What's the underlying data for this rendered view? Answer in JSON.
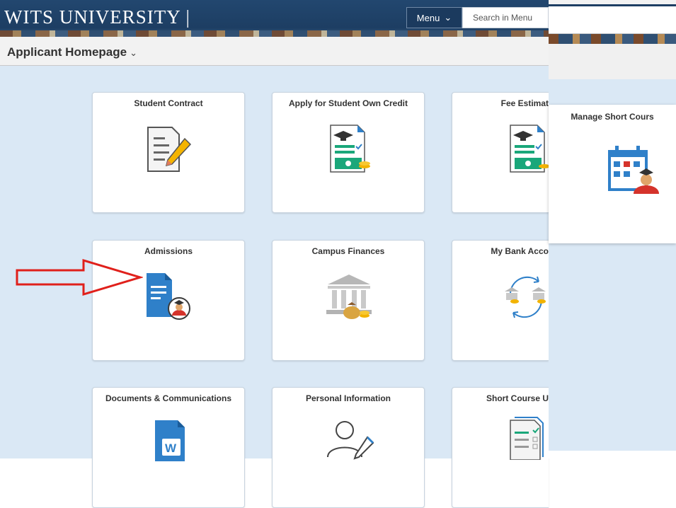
{
  "header": {
    "brand": "WITS UNIVERSITY |",
    "menu_label": "Menu",
    "search_placeholder": "Search in Menu"
  },
  "page": {
    "title": "Applicant Homepage",
    "title_caret": "⌄"
  },
  "tiles": [
    {
      "label": "Student Contract",
      "icon": "contract-document-icon"
    },
    {
      "label": "Apply for Student Own Credit",
      "icon": "credit-application-icon"
    },
    {
      "label": "Fee Estimat",
      "icon": "fee-estimate-icon"
    },
    {
      "label": "Admissions",
      "icon": "admissions-icon"
    },
    {
      "label": "Campus Finances",
      "icon": "campus-finances-icon"
    },
    {
      "label": "My Bank Acco",
      "icon": "bank-account-icon"
    },
    {
      "label": "Documents & Communications",
      "icon": "word-document-icon"
    },
    {
      "label": "Personal Information",
      "icon": "person-icon"
    },
    {
      "label": "Short Course U",
      "icon": "checklist-icon"
    }
  ],
  "popup_tile": {
    "label": "Manage Short Cours",
    "icon": "calendar-student-icon"
  },
  "colors": {
    "header_bg": "#1d3e63",
    "content_bg": "#dae8f5",
    "icon_blue": "#2f80c9",
    "icon_green": "#1aa77a",
    "annotation_red": "#e0201b"
  }
}
